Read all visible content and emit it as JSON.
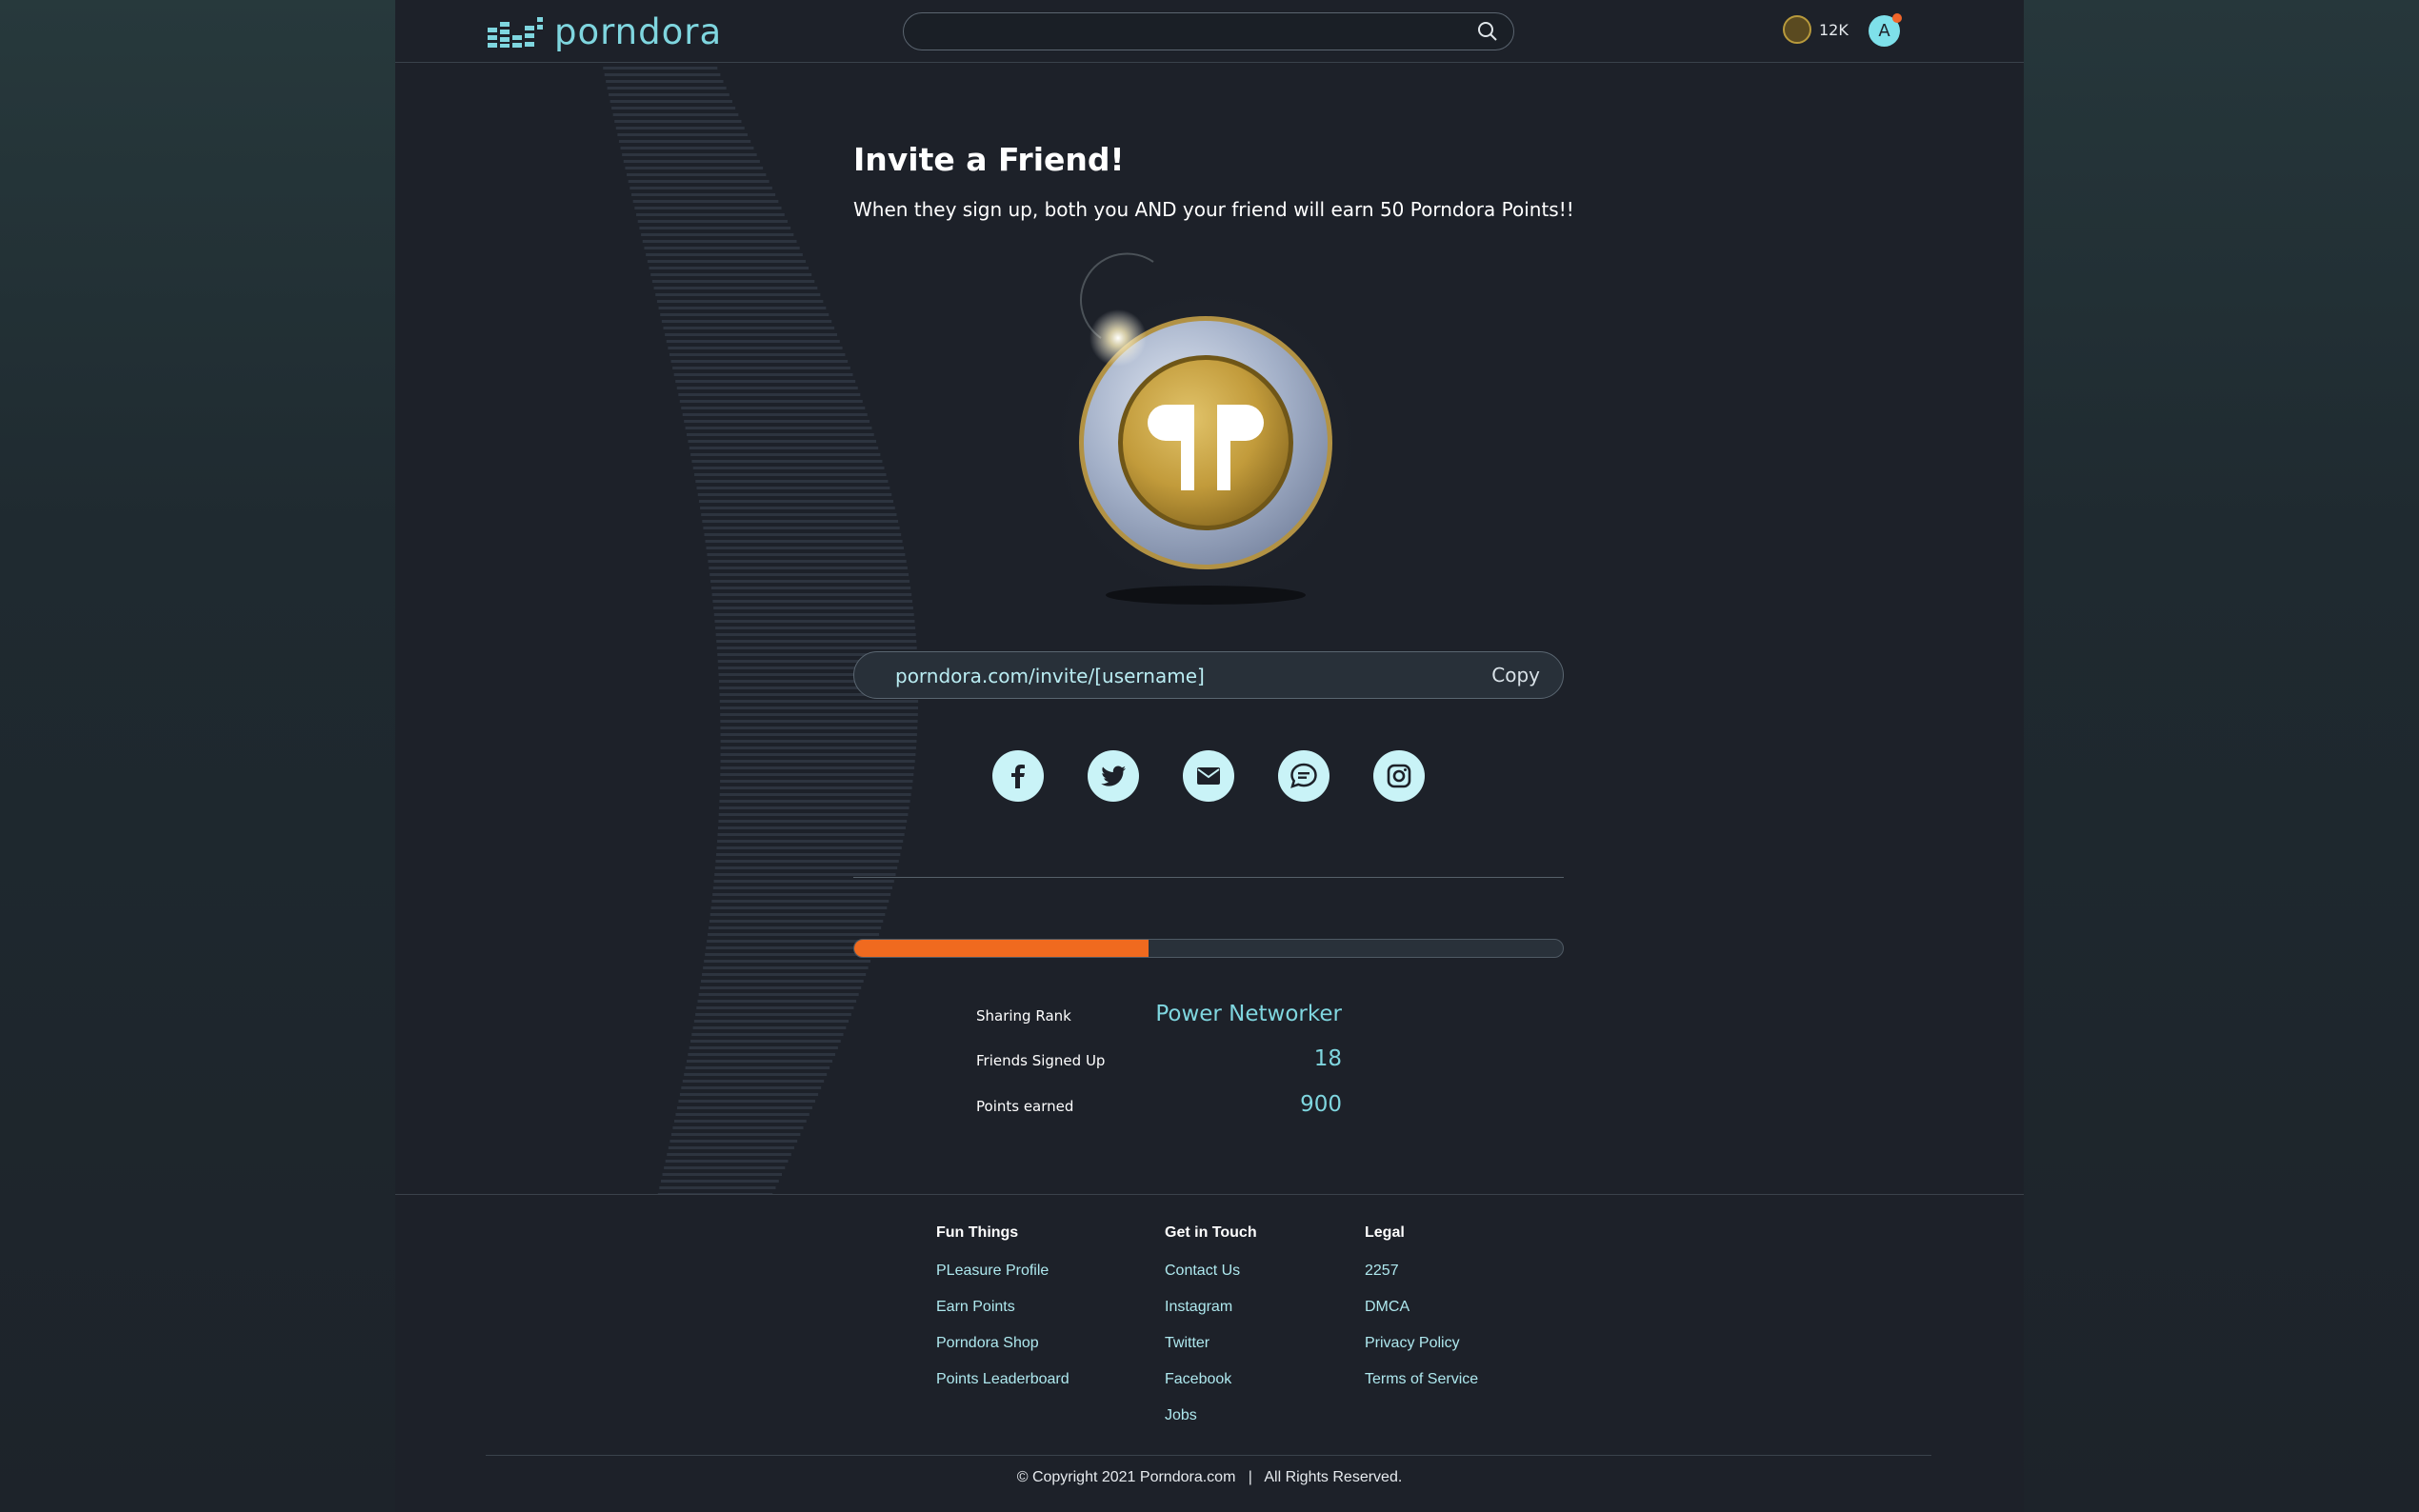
{
  "header": {
    "brand": "porndora",
    "search_placeholder": "",
    "points": "12K",
    "avatar_initial": "A"
  },
  "invite": {
    "title": "Invite a Friend!",
    "subtitle": "When they sign up, both you AND your friend will earn 50 Porndora Points!!",
    "url": "porndora.com/invite/[username]",
    "copy_label": "Copy",
    "socials": [
      "facebook-icon",
      "twitter-icon",
      "mail-icon",
      "chat-icon",
      "instagram-icon"
    ]
  },
  "progress": {
    "fraction": 0.415,
    "color": "#f06a1f"
  },
  "stats": [
    {
      "label": "Sharing Rank",
      "value": "Power Networker"
    },
    {
      "label": "Friends Signed Up",
      "value": "18"
    },
    {
      "label": "Points earned",
      "value": "900"
    }
  ],
  "footer": {
    "columns": [
      {
        "heading": "Fun Things",
        "links": [
          "PLeasure Profile",
          "Earn Points",
          "Porndora Shop",
          "Points Leaderboard"
        ]
      },
      {
        "heading": "Get in Touch",
        "links": [
          "Contact Us",
          "Instagram",
          "Twitter",
          "Facebook",
          "Jobs"
        ]
      },
      {
        "heading": "Legal",
        "links": [
          "2257",
          "DMCA",
          "Privacy Policy",
          "Terms of Service"
        ]
      }
    ],
    "copyright": "© Copyright 2021 Porndora.com   |   All Rights Reserved."
  },
  "colors": {
    "accent": "#7fd6df",
    "background": "#1d2129",
    "progress": "#f06a1f"
  }
}
